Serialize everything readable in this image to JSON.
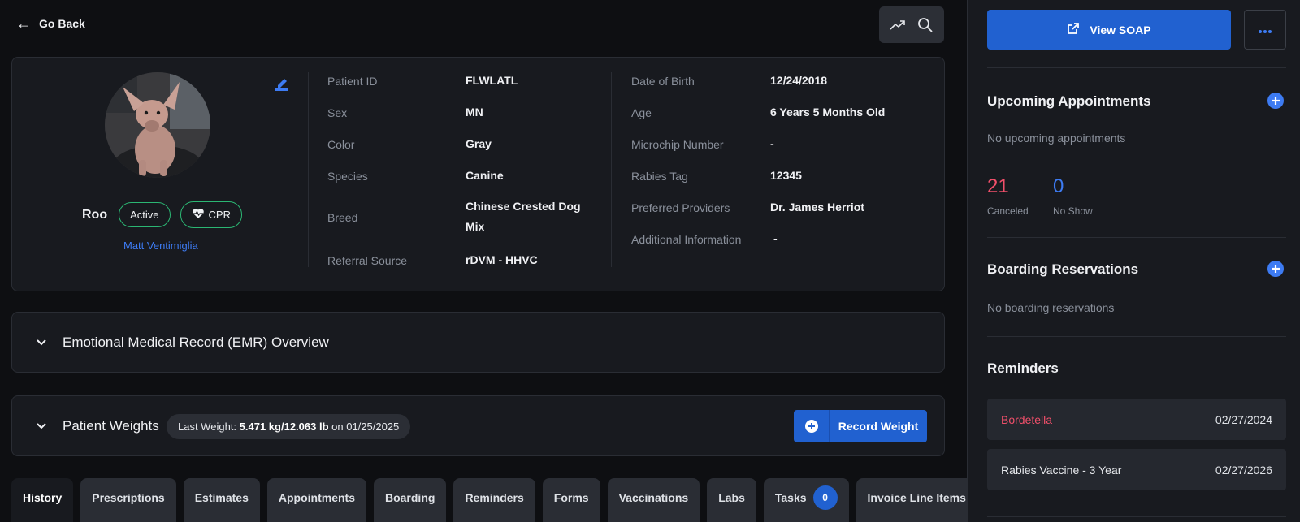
{
  "nav": {
    "go_back": "Go Back"
  },
  "patient": {
    "name": "Roo",
    "badges": [
      "Active",
      "CPR"
    ],
    "owner": "Matt Ventimiglia",
    "fields_left": [
      {
        "label": "Patient ID",
        "value": "FLWLATL"
      },
      {
        "label": "Sex",
        "value": "MN"
      },
      {
        "label": "Color",
        "value": "Gray"
      },
      {
        "label": "Species",
        "value": "Canine"
      },
      {
        "label": "Breed",
        "value": "Chinese Crested Dog Mix"
      },
      {
        "label": "Referral Source",
        "value": "rDVM - HHVC"
      }
    ],
    "fields_right": [
      {
        "label": "Date of Birth",
        "value": "12/24/2018"
      },
      {
        "label": "Age",
        "value": "6 Years 5 Months Old"
      },
      {
        "label": "Microchip Number",
        "value": "-"
      },
      {
        "label": "Rabies Tag",
        "value": "12345"
      },
      {
        "label": "Preferred Providers",
        "value": "Dr. James Herriot"
      },
      {
        "label": "Additional Information",
        "value": "-"
      }
    ]
  },
  "emr": {
    "title": "Emotional Medical Record (EMR) Overview"
  },
  "weights": {
    "title": "Patient Weights",
    "last_weight_prefix": "Last Weight:",
    "last_weight_value": "5.471 kg/12.063 lb",
    "last_weight_suffix": "on 01/25/2025",
    "record_button": "Record Weight"
  },
  "tabs": [
    {
      "label": "History",
      "active": true
    },
    {
      "label": "Prescriptions"
    },
    {
      "label": "Estimates"
    },
    {
      "label": "Appointments"
    },
    {
      "label": "Boarding"
    },
    {
      "label": "Reminders"
    },
    {
      "label": "Forms"
    },
    {
      "label": "Vaccinations"
    },
    {
      "label": "Labs"
    },
    {
      "label": "Tasks",
      "count": "0"
    },
    {
      "label": "Invoice Line Items"
    }
  ],
  "sidebar": {
    "view_soap": "View SOAP",
    "upcoming": {
      "title": "Upcoming Appointments",
      "empty": "No upcoming appointments",
      "canceled_count": "21",
      "canceled_label": "Canceled",
      "noshow_count": "0",
      "noshow_label": "No Show"
    },
    "boarding": {
      "title": "Boarding Reservations",
      "empty": "No boarding reservations"
    },
    "reminders": {
      "title": "Reminders",
      "items": [
        {
          "name": "Bordetella",
          "date": "02/27/2024",
          "overdue": true
        },
        {
          "name": "Rabies Vaccine - 3 Year",
          "date": "02/27/2026",
          "overdue": false
        }
      ]
    }
  },
  "colors": {
    "accent": "#2161d0",
    "link": "#3d7bf2",
    "success": "#2bb673",
    "danger": "#f04f6a"
  }
}
